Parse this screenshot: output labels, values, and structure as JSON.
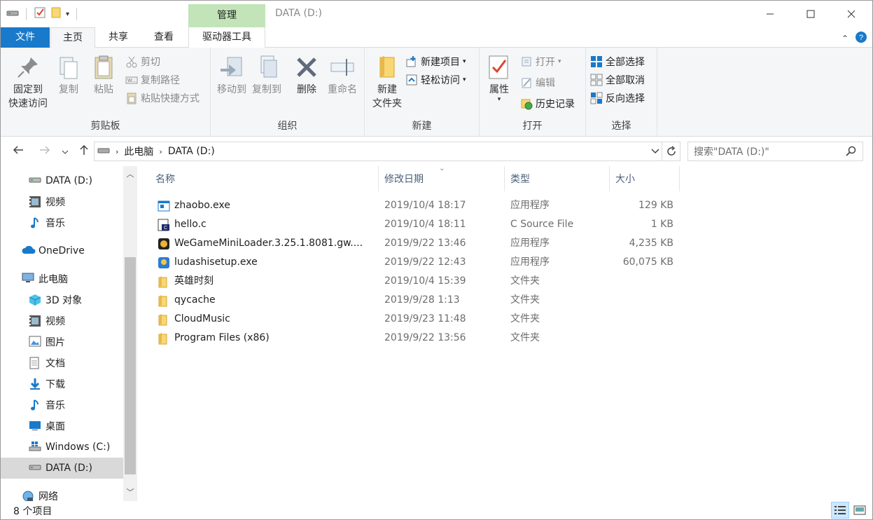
{
  "window": {
    "title": "DATA (D:)",
    "manage_tab": "管理"
  },
  "tabs": {
    "file": "文件",
    "home": "主页",
    "share": "共享",
    "view": "查看",
    "drive_tools": "驱动器工具"
  },
  "ribbon": {
    "clipboard": {
      "label": "剪贴板",
      "pin_line1": "固定到",
      "pin_line2": "快速访问",
      "copy": "复制",
      "paste": "粘贴",
      "cut": "剪切",
      "copy_path": "复制路径",
      "paste_shortcut": "粘贴快捷方式"
    },
    "organize": {
      "label": "组织",
      "move_to": "移动到",
      "copy_to": "复制到",
      "delete": "删除",
      "rename": "重命名"
    },
    "new": {
      "label": "新建",
      "new_folder_line1": "新建",
      "new_folder_line2": "文件夹",
      "new_item": "新建项目",
      "easy_access": "轻松访问"
    },
    "open": {
      "label": "打开",
      "properties": "属性",
      "open": "打开",
      "edit": "编辑",
      "history": "历史记录"
    },
    "select": {
      "label": "选择",
      "select_all": "全部选择",
      "select_none": "全部取消",
      "invert": "反向选择"
    }
  },
  "address": {
    "crumb1": "此电脑",
    "crumb2": "DATA (D:)",
    "search_placeholder": "搜索\"DATA (D:)\""
  },
  "nav": {
    "items": [
      {
        "label": "DATA (D:)",
        "icon": "drive-icon"
      },
      {
        "label": "视频",
        "icon": "video-icon"
      },
      {
        "label": "音乐",
        "icon": "music-icon"
      },
      {
        "label": "OneDrive",
        "icon": "onedrive-icon"
      },
      {
        "label": "此电脑",
        "icon": "this-pc-icon"
      },
      {
        "label": "3D 对象",
        "icon": "3d-objects-icon"
      },
      {
        "label": "视频",
        "icon": "video-icon"
      },
      {
        "label": "图片",
        "icon": "pictures-icon"
      },
      {
        "label": "文档",
        "icon": "documents-icon"
      },
      {
        "label": "下载",
        "icon": "downloads-icon"
      },
      {
        "label": "音乐",
        "icon": "music-icon"
      },
      {
        "label": "桌面",
        "icon": "desktop-icon"
      },
      {
        "label": "Windows (C:)",
        "icon": "windows-drive-icon"
      },
      {
        "label": "DATA (D:)",
        "icon": "drive-icon"
      },
      {
        "label": "网络",
        "icon": "network-icon"
      }
    ]
  },
  "columns": {
    "name": "名称",
    "date": "修改日期",
    "type": "类型",
    "size": "大小"
  },
  "files": [
    {
      "name": "zhaobo.exe",
      "date": "2019/10/4 18:17",
      "type": "应用程序",
      "size": "129 KB",
      "icon": "exe-icon"
    },
    {
      "name": "hello.c",
      "date": "2019/10/4 18:11",
      "type": "C Source File",
      "size": "1 KB",
      "icon": "c-file-icon"
    },
    {
      "name": "WeGameMiniLoader.3.25.1.8081.gw....",
      "date": "2019/9/22 13:46",
      "type": "应用程序",
      "size": "4,235 KB",
      "icon": "wegame-icon"
    },
    {
      "name": "ludashisetup.exe",
      "date": "2019/9/22 12:43",
      "type": "应用程序",
      "size": "60,075 KB",
      "icon": "ludashi-icon"
    },
    {
      "name": "英雄时刻",
      "date": "2019/10/4 15:39",
      "type": "文件夹",
      "size": "",
      "icon": "folder-icon"
    },
    {
      "name": "qycache",
      "date": "2019/9/28 1:13",
      "type": "文件夹",
      "size": "",
      "icon": "folder-icon"
    },
    {
      "name": "CloudMusic",
      "date": "2019/9/23 11:48",
      "type": "文件夹",
      "size": "",
      "icon": "folder-icon"
    },
    {
      "name": "Program Files (x86)",
      "date": "2019/9/22 13:56",
      "type": "文件夹",
      "size": "",
      "icon": "folder-icon"
    }
  ],
  "status": {
    "count": "8 个项目"
  },
  "colors": {
    "accent": "#1979ca",
    "manage_tab": "#c2e4b8",
    "folder": "#f8d775",
    "selected": "#d9d9d9"
  }
}
